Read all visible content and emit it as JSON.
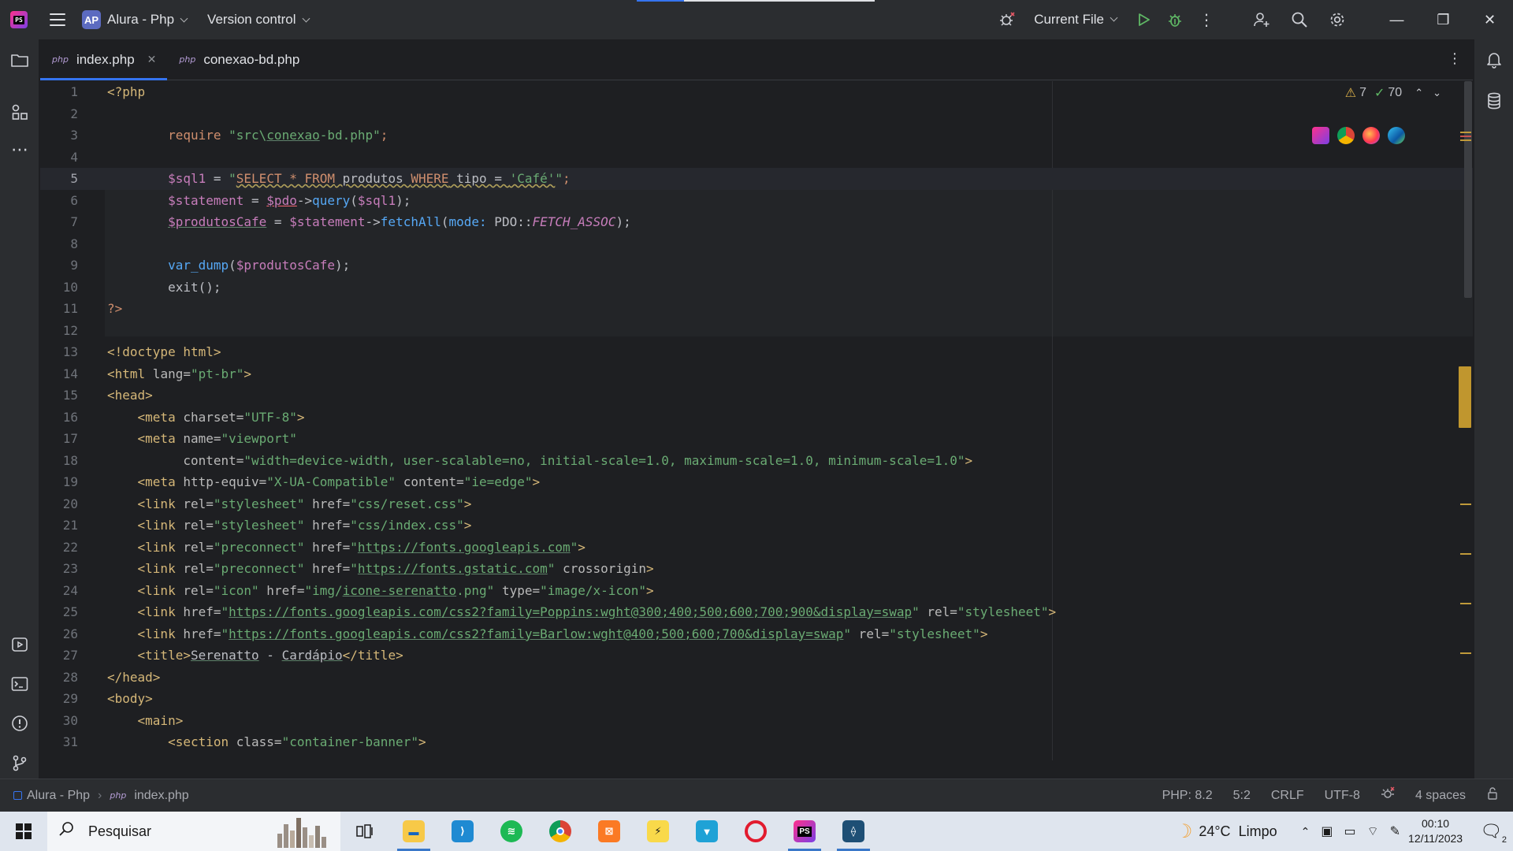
{
  "titlebar": {
    "project_badge": "AP",
    "project_name": "Alura - Php",
    "version_control": "Version control",
    "run_config": "Current File"
  },
  "tabs": [
    {
      "lang": "php",
      "name": "index.php",
      "active": true
    },
    {
      "lang": "php",
      "name": "conexao-bd.php",
      "active": false
    }
  ],
  "inspections": {
    "warnings": "7",
    "ok": "70"
  },
  "status": {
    "project": "Alura - Php",
    "file_lang": "php",
    "file": "index.php",
    "php_version": "PHP: 8.2",
    "caret": "5:2",
    "line_sep": "CRLF",
    "encoding": "UTF-8",
    "indent": "4 spaces"
  },
  "taskbar": {
    "search_placeholder": "Pesquisar",
    "temperature": "24°C",
    "weather": "Limpo",
    "time": "00:10",
    "date": "12/11/2023",
    "notifications": "2"
  },
  "colors": {
    "accent": "#3574f0",
    "editor_bg": "#1e1f22",
    "chrome_bg": "#2b2d30"
  },
  "code": {
    "l1": [
      "<?php"
    ],
    "l3": [
      "require",
      " \"src\\",
      "conexao",
      "-bd.php\"",
      ";"
    ],
    "l5": [
      "$sql1",
      " = ",
      "\"",
      "SELECT * FROM",
      " produtos ",
      "WHERE",
      " tipo = ",
      "'Café'",
      "\"",
      ";"
    ],
    "l6": [
      "$statement",
      " = ",
      "$pdo",
      "->",
      "query",
      "(",
      "$sql1",
      ");"
    ],
    "l7": [
      "$produtosCafe",
      " = ",
      "$statement",
      "->",
      "fetchAll",
      "(",
      "mode:",
      " PDO::",
      "FETCH_ASSOC",
      ");"
    ],
    "l9": [
      "var_dump",
      "(",
      "$produtosCafe",
      ");"
    ],
    "l10": [
      "exit",
      "();"
    ],
    "l11": [
      "?>"
    ],
    "l13": [
      "<!doctype html>"
    ],
    "l14": [
      "<html",
      " lang=",
      "\"pt-br\"",
      ">"
    ],
    "l15": [
      "<head>"
    ],
    "l16": [
      "<meta",
      " charset=",
      "\"UTF-8\"",
      ">"
    ],
    "l17": [
      "<meta",
      " name=",
      "\"viewport\""
    ],
    "l18": [
      "content=",
      "\"width=device-width, user-scalable=no, initial-scale=1.0, maximum-scale=1.0, minimum-scale=1.0\"",
      ">"
    ],
    "l19": [
      "<meta",
      " http-equiv=",
      "\"X-UA-Compatible\"",
      " content=",
      "\"ie=edge\"",
      ">"
    ],
    "l20": [
      "<link",
      " rel=",
      "\"stylesheet\"",
      " href=",
      "\"css/reset.css\"",
      ">"
    ],
    "l21": [
      "<link",
      " rel=",
      "\"stylesheet\"",
      " href=",
      "\"css/index.css\"",
      ">"
    ],
    "l22": [
      "<link",
      " rel=",
      "\"preconnect\"",
      " href=",
      "\"",
      "https://fonts.googleapis.com",
      "\"",
      ">"
    ],
    "l23": [
      "<link",
      " rel=",
      "\"preconnect\"",
      " href=",
      "\"",
      "https://fonts.gstatic.com",
      "\"",
      " crossorigin",
      ">"
    ],
    "l24": [
      "<link",
      " rel=",
      "\"icon\"",
      " href=",
      "\"img/",
      "icone-serenatto",
      ".png\"",
      " type=",
      "\"image/x-icon\"",
      ">"
    ],
    "l25": [
      "<link",
      " href=",
      "\"",
      "https://fonts.googleapis.com/css2?family=Poppins:wght@300;400;500;600;700;900&display=swap",
      "\"",
      " rel=",
      "\"stylesheet\"",
      ">"
    ],
    "l26": [
      "<link",
      " href=",
      "\"",
      "https://fonts.googleapis.com/css2?family=Barlow:wght@400;500;600;700&display=swap",
      "\"",
      " rel=",
      "\"stylesheet\"",
      ">"
    ],
    "l27": [
      "<title>",
      "Serenatto",
      " - ",
      "Cardápio",
      "</title>"
    ],
    "l28": [
      "</head>"
    ],
    "l29": [
      "<body>"
    ],
    "l30": [
      "<main>"
    ],
    "l31": [
      "<section",
      " class=",
      "\"container-banner\"",
      ">"
    ]
  }
}
